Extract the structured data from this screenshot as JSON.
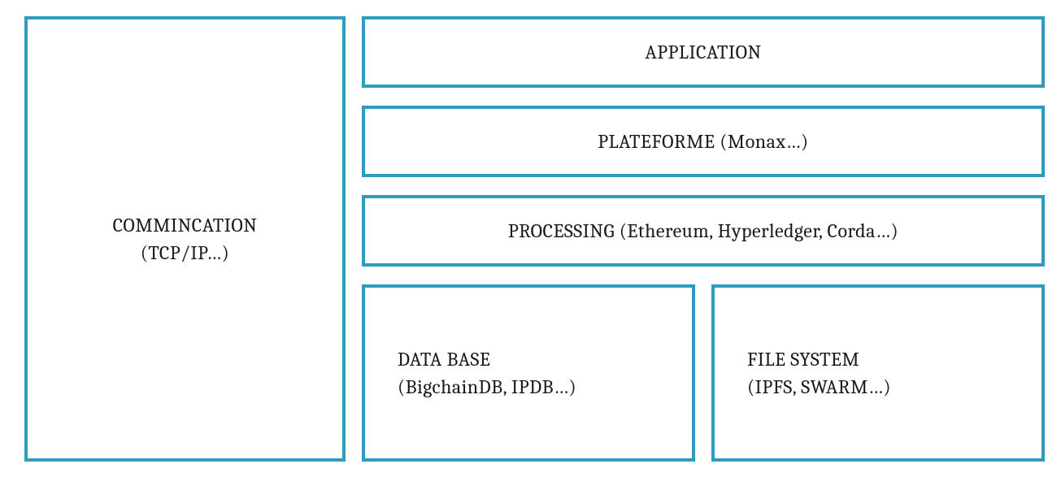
{
  "communication": {
    "title": "COMMINCATION",
    "subtitle": "(TCP/IP…)"
  },
  "application": {
    "label": "APPLICATION"
  },
  "platform": {
    "label": "PLATEFORME (Monax…)"
  },
  "processing": {
    "label": "PROCESSING (Ethereum, Hyperledger, Corda…)"
  },
  "database": {
    "title": "DATA BASE",
    "subtitle": "(BigchainDB, IPDB…)"
  },
  "filesystem": {
    "title": "FILE SYSTEM",
    "subtitle": "(IPFS, SWARM…)"
  }
}
